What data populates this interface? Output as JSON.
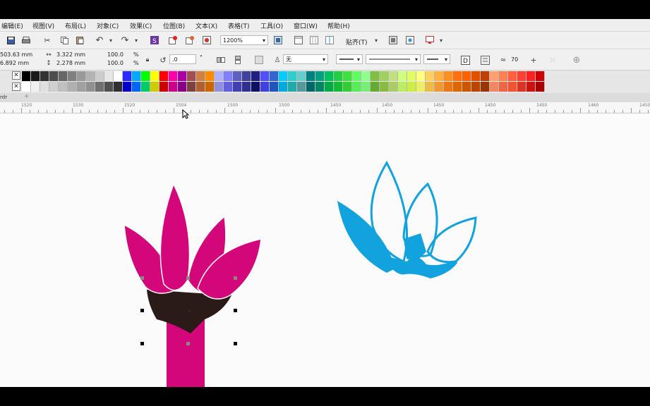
{
  "menu": [
    "编辑(E)",
    "视图(V)",
    "布局(L)",
    "对象(C)",
    "效果(C)",
    "位图(B)",
    "文本(X)",
    "表格(T)",
    "工具(O)",
    "窗口(W)",
    "帮助(H)"
  ],
  "toolbar1": {
    "zoom_value": "1200%",
    "snap_label": "贴齐(T)"
  },
  "props": {
    "x_value": "503.63 mm",
    "y_value": "6.892 mm",
    "width_value": "3.322 mm",
    "height_value": "2.278 mm",
    "scale_x": "100.0",
    "scale_y": "100.0",
    "percent": "%",
    "rotation": ".0",
    "degree": "°",
    "outline_none": "无",
    "smooth_value": "70"
  },
  "palette": {
    "row1": [
      "#000000",
      "#1a1a1a",
      "#333333",
      "#4d4d4d",
      "#666666",
      "#808080",
      "#999999",
      "#b3b3b3",
      "#cccccc",
      "#e6e6e6",
      "#ffffff",
      "#2a2aff",
      "#00aaff",
      "#00ff00",
      "#ffff00",
      "#ff0000",
      "#ff00aa",
      "#aa00aa",
      "#a05050",
      "#d08040",
      "#ff8c00",
      "#b0b0ff",
      "#8080ff",
      "#6060c0",
      "#4040a0",
      "#202080",
      "#5050ff",
      "#3366cc",
      "#00ccff",
      "#33cccc",
      "#66cccc",
      "#008080",
      "#00a080",
      "#00c060",
      "#20d040",
      "#40e040",
      "#60ff60",
      "#90ff90",
      "#80c040",
      "#a0d060",
      "#c0e080",
      "#d0ff80",
      "#e0ff60",
      "#ffff80",
      "#ffd060",
      "#ffb040",
      "#ff9020",
      "#ff7010",
      "#ff6000",
      "#e05000",
      "#c04000",
      "#ffa070",
      "#ff8050",
      "#ff6040",
      "#ff4030",
      "#ff2020",
      "#d00000"
    ],
    "row2": [
      "#ffffff",
      "#f0f0f0",
      "#e0e0e0",
      "#d0d0d0",
      "#c0c0c0",
      "#b0b0b0",
      "#a0a0a0",
      "#909090",
      "#707070",
      "#505050",
      "#303030",
      "#0000cc",
      "#0066ff",
      "#00cc66",
      "#cccc00",
      "#cc0000",
      "#cc0088",
      "#880088",
      "#804040",
      "#b06030",
      "#cc6600",
      "#9090e0",
      "#6060e0",
      "#4040b0",
      "#303090",
      "#101060",
      "#4040e0",
      "#2255bb",
      "#00aadd",
      "#22aaaa",
      "#559999",
      "#006666",
      "#008866",
      "#00aa44",
      "#11bb33",
      "#33cc33",
      "#55ee55",
      "#77ee77",
      "#66aa33",
      "#88bb44",
      "#aacc66",
      "#bbee66",
      "#ccee44",
      "#eeee66",
      "#eebb44",
      "#ee9933",
      "#ee7711",
      "#dd6600",
      "#cc5500",
      "#bb4400",
      "#993300",
      "#ee8866",
      "#ee6644",
      "#ee5533",
      "#dd3322",
      "#cc1111",
      "#aa0000"
    ]
  },
  "tab_label": "rdr",
  "ruler_labels": [
    "1520",
    "1530",
    "1520",
    "1504",
    "1500",
    "1500",
    "1450",
    "1450",
    "1450",
    "1450",
    "1450",
    "1460",
    "1450"
  ],
  "colors": {
    "magenta": "#d4077a",
    "dark_brown": "#2a1a18",
    "cyan": "#12a3de"
  }
}
